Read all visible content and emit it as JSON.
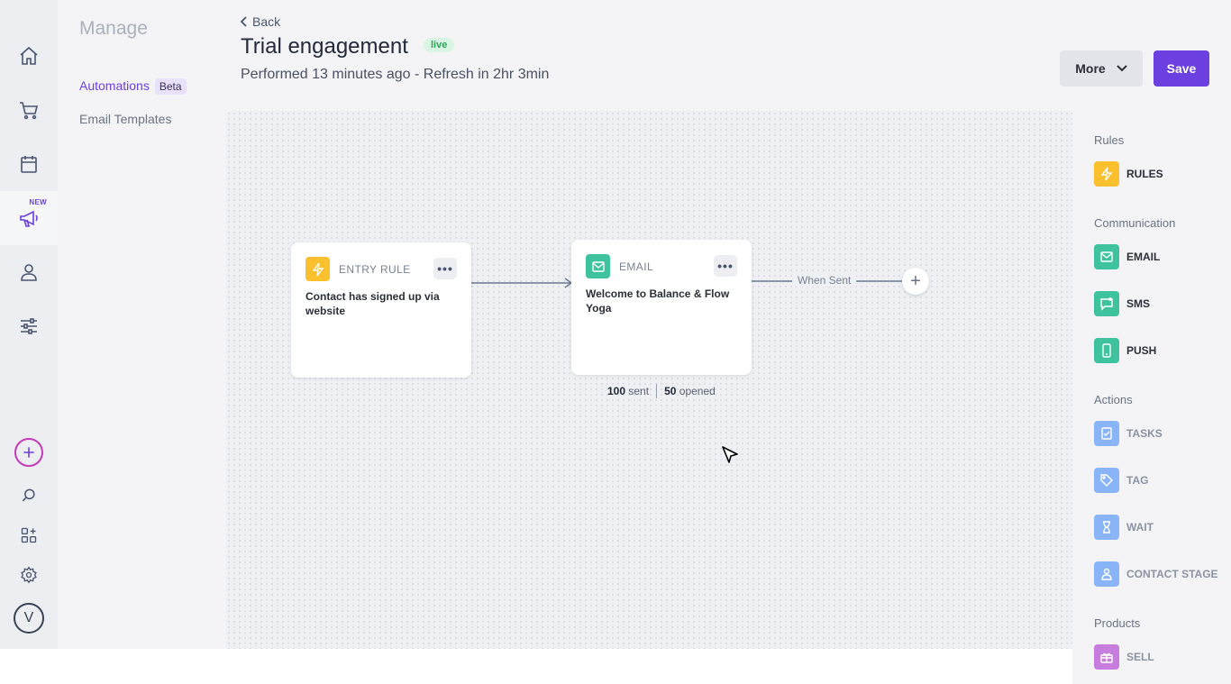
{
  "rail": {
    "new_label": "NEW",
    "avatar_initial": "V"
  },
  "subnav": {
    "title": "Manage",
    "items": [
      {
        "label": "Automations",
        "badge": "Beta"
      },
      {
        "label": "Email Templates"
      }
    ]
  },
  "header": {
    "back_label": "Back",
    "title": "Trial engagement",
    "status": "live",
    "subtitle": "Performed 13 minutes ago - Refresh in 2hr 3min",
    "more_label": "More",
    "save_label": "Save"
  },
  "canvas": {
    "entry_card": {
      "type": "ENTRY RULE",
      "text": "Contact has signed up via website",
      "icon": "lightning-icon"
    },
    "email_card": {
      "type": "EMAIL",
      "text": "Welcome to Balance & Flow Yoga",
      "icon": "mail-icon"
    },
    "stats": {
      "sent_count": "100",
      "sent_label": "sent",
      "opened_count": "50",
      "opened_label": "opened"
    },
    "edge_label": "When Sent"
  },
  "panel": {
    "sections": [
      {
        "title": "Rules",
        "items": [
          {
            "label": "RULES",
            "icon": "lightning-icon",
            "color": "#fbc02d"
          }
        ]
      },
      {
        "title": "Communication",
        "items": [
          {
            "label": "EMAIL",
            "icon": "mail-icon",
            "color": "#3fc39f"
          },
          {
            "label": "SMS",
            "icon": "message-icon",
            "color": "#3fc39f"
          },
          {
            "label": "PUSH",
            "icon": "phone-icon",
            "color": "#3fc39f"
          }
        ]
      },
      {
        "title": "Actions",
        "items": [
          {
            "label": "TASKS",
            "icon": "task-icon",
            "color": "#8ab4f8"
          },
          {
            "label": "TAG",
            "icon": "tag-icon",
            "color": "#8ab4f8"
          },
          {
            "label": "WAIT",
            "icon": "hourglass-icon",
            "color": "#8ab4f8"
          },
          {
            "label": "CONTACT STAGE",
            "icon": "person-icon",
            "color": "#8ab4f8"
          }
        ]
      },
      {
        "title": "Products",
        "items": [
          {
            "label": "SELL",
            "icon": "gift-icon",
            "color": "#c77dde"
          }
        ]
      }
    ]
  },
  "colors": {
    "accent": "#6b3fe0",
    "live_bg": "#d9f5e3",
    "live_text": "#2fa35a",
    "rules": "#fbc02d",
    "communication": "#3fc39f",
    "actions": "#8ab4f8",
    "products": "#c77dde"
  }
}
